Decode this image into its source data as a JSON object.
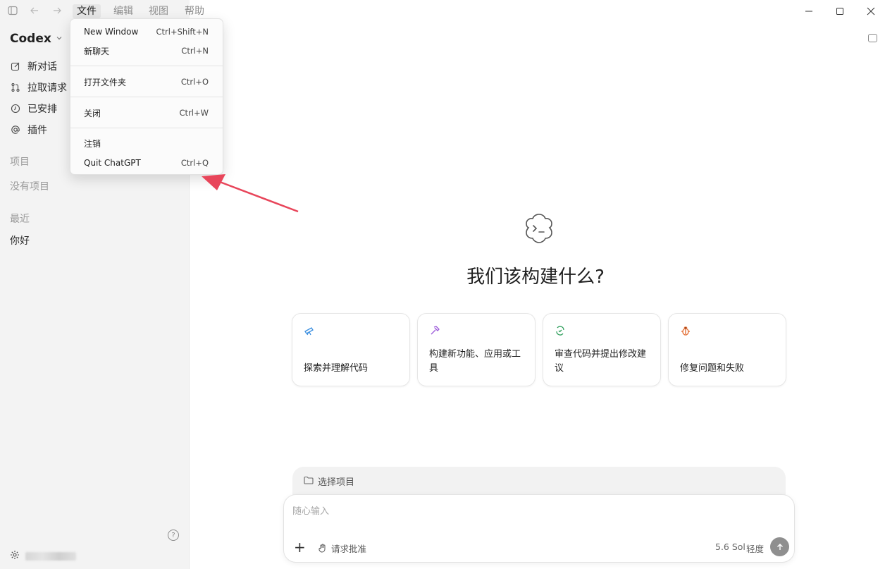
{
  "menubar": {
    "items": [
      "文件",
      "编辑",
      "视图",
      "帮助"
    ]
  },
  "file_menu": {
    "items": [
      {
        "label": "New Window",
        "shortcut": "Ctrl+Shift+N"
      },
      {
        "label": "新聊天",
        "shortcut": "Ctrl+N"
      },
      {
        "label": "打开文件夹",
        "shortcut": "Ctrl+O"
      },
      {
        "label": "关闭",
        "shortcut": "Ctrl+W"
      },
      {
        "label": "注销",
        "shortcut": ""
      },
      {
        "label": "Quit ChatGPT",
        "shortcut": "Ctrl+Q"
      }
    ]
  },
  "sidebar": {
    "brand": "Codex",
    "nav": [
      {
        "label": "新对话",
        "icon": "compose-icon"
      },
      {
        "label": "拉取请求",
        "icon": "pull-request-icon"
      },
      {
        "label": "已安排",
        "icon": "clock-icon"
      },
      {
        "label": "插件",
        "icon": "at-icon"
      }
    ],
    "projects_label": "项目",
    "no_projects": "没有项目",
    "recent_label": "最近",
    "recent_items": [
      "你好"
    ]
  },
  "main": {
    "headline": "我们该构建什么?",
    "cards": [
      {
        "label": "探索并理解代码",
        "icon": "telescope-icon",
        "color": "#3b8fe0"
      },
      {
        "label": "构建新功能、应用或工具",
        "icon": "hammer-icon",
        "color": "#9b59d9"
      },
      {
        "label": "审查代码并提出修改建议",
        "icon": "review-icon",
        "color": "#2e9e5b"
      },
      {
        "label": "修复问题和失败",
        "icon": "bug-icon",
        "color": "#e2672b"
      }
    ],
    "project_select": "选择项目",
    "composer": {
      "placeholder": "随心输入",
      "approval": "请求批准",
      "model": "5.6 Sol",
      "effort": "轻度"
    }
  },
  "colors": {
    "annotation_arrow": "#e8455a",
    "send_button": "#8f8f8f"
  }
}
